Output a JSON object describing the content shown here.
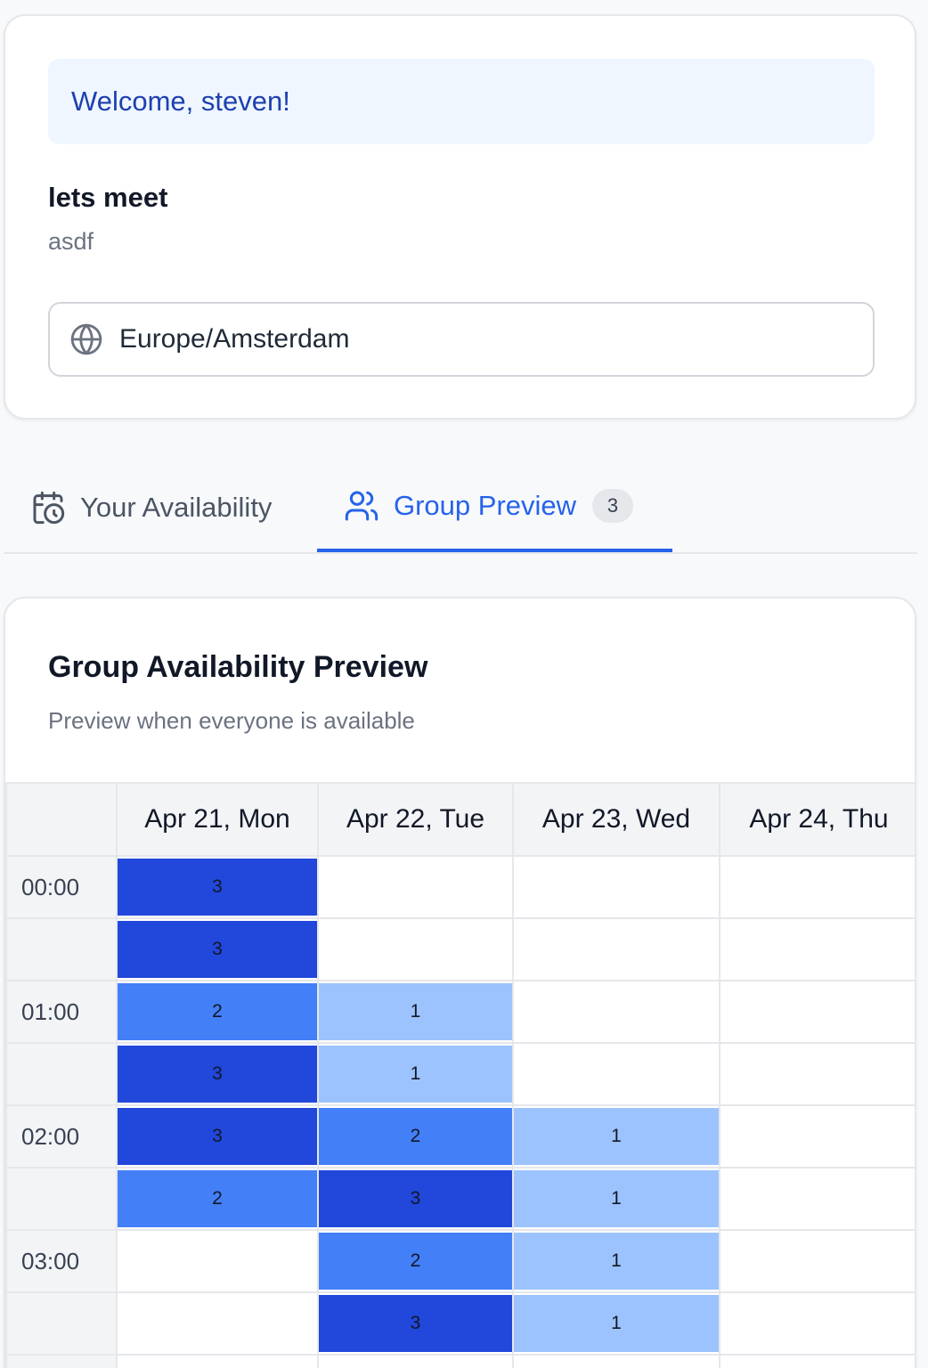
{
  "welcome": "Welcome, steven!",
  "event": {
    "title": "lets meet",
    "description": "asdf"
  },
  "timezone": {
    "icon": "globe-icon",
    "value": "Europe/Amsterdam"
  },
  "tabs": [
    {
      "label": "Your Availability",
      "icon": "calendar-clock-icon",
      "active": false
    },
    {
      "label": "Group Preview",
      "icon": "users-icon",
      "active": true,
      "count": "3"
    }
  ],
  "preview": {
    "title": "Group Availability Preview",
    "subtitle": "Preview when everyone is available",
    "columns": [
      "Apr 21, Mon",
      "Apr 22, Tue",
      "Apr 23, Wed",
      "Apr 24, Thu"
    ],
    "rows": [
      {
        "time": "00:00",
        "counts": [
          "3",
          "",
          "",
          ""
        ]
      },
      {
        "time": "",
        "counts": [
          "3",
          "",
          "",
          ""
        ]
      },
      {
        "time": "01:00",
        "counts": [
          "2",
          "1",
          "",
          ""
        ]
      },
      {
        "time": "",
        "counts": [
          "3",
          "1",
          "",
          ""
        ]
      },
      {
        "time": "02:00",
        "counts": [
          "3",
          "2",
          "1",
          ""
        ]
      },
      {
        "time": "",
        "counts": [
          "2",
          "3",
          "1",
          ""
        ]
      },
      {
        "time": "03:00",
        "counts": [
          "",
          "2",
          "1",
          ""
        ]
      },
      {
        "time": "",
        "counts": [
          "",
          "3",
          "1",
          ""
        ]
      },
      {
        "time": "",
        "counts": [
          "",
          "",
          "",
          ""
        ]
      }
    ]
  },
  "colors": {
    "level_1": "#9cc3fd",
    "level_2": "#437ff7",
    "level_3": "#2147db",
    "accent": "#2563eb"
  }
}
